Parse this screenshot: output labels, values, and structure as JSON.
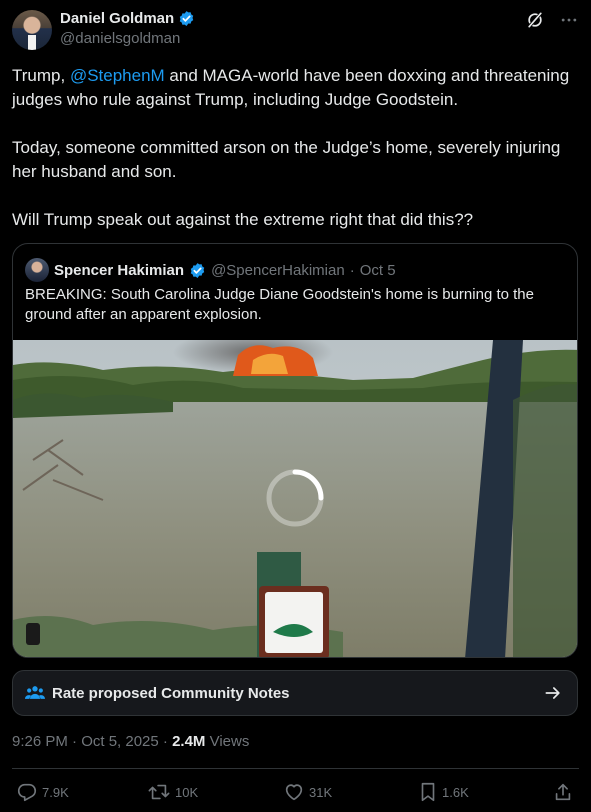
{
  "author": {
    "name": "Daniel Goldman",
    "handle": "@danielsgoldman"
  },
  "tweet": {
    "p1_pre": "Trump, ",
    "p1_mention": "@StephenM",
    "p1_post": " and MAGA-world have been doxxing and threatening judges who rule against Trump, including Judge Goodstein.",
    "p2": "Today, someone committed arson on the Judge’s home, severely injuring her husband and son.",
    "p3": "Will Trump speak out against the extreme right that did this??"
  },
  "quote": {
    "name": "Spencer Hakimian",
    "handle": "@SpencerHakimian",
    "separator": "·",
    "date": "Oct 5",
    "text": "BREAKING: South Carolina Judge Diane Goodstein's home is burning to the ground after an apparent explosion."
  },
  "community_notes": {
    "label": "Rate proposed Community Notes"
  },
  "meta": {
    "timestamp": "9:26 PM · Oct 5, 2025 · ",
    "views_count": "2.4M",
    "views_label": " Views"
  },
  "actions": {
    "replies": "7.9K",
    "reposts": "10K",
    "likes": "31K",
    "bookmarks": "1.6K"
  },
  "colors": {
    "accent": "#1d9bf0",
    "background": "#000000",
    "secondary_text": "#71767b",
    "border": "#2f3336"
  },
  "icons": {
    "verified": "verified-badge-icon",
    "grok": "grok-icon",
    "more": "more-icon",
    "community_notes": "community-notes-icon",
    "arrow": "arrow-right-icon",
    "reply": "reply-icon",
    "repost": "repost-icon",
    "like": "like-icon",
    "bookmark": "bookmark-icon",
    "share": "share-icon",
    "loading": "loading-spinner-icon"
  }
}
